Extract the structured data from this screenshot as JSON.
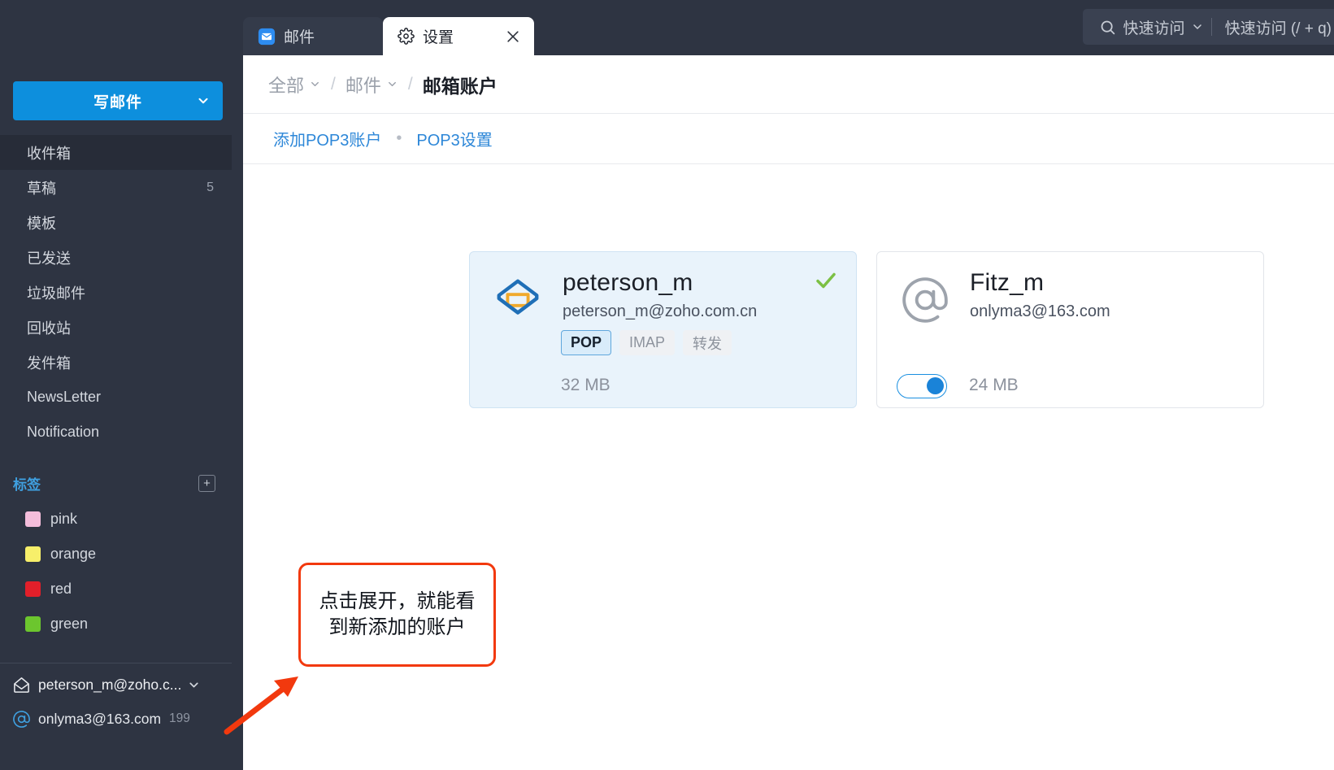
{
  "colors": {
    "sidebar_bg": "#2e3442",
    "accent_blue": "#0d8fdd",
    "link_blue": "#2d87d8",
    "annotation_red": "#f2390e",
    "check_green": "#7cc044",
    "card_selected_bg": "#e9f3fb"
  },
  "topbar": {
    "tabs": [
      {
        "label": "邮件",
        "icon": "mail-app-icon",
        "active": false,
        "closable": false
      },
      {
        "label": "设置",
        "icon": "gear-icon",
        "active": true,
        "closable": true
      }
    ],
    "close_glyph": "✕",
    "quick_access": {
      "search_icon": "search-icon",
      "label": "快速访问",
      "caret_icon": "chevron-down-icon",
      "hint": "快速访问 (/ + q)"
    }
  },
  "sidebar": {
    "compose": {
      "label": "写邮件",
      "caret_icon": "chevron-down-icon"
    },
    "nav_items": [
      {
        "label": "收件箱",
        "count": "",
        "selected": true
      },
      {
        "label": "草稿",
        "count": "5",
        "selected": false
      },
      {
        "label": "模板",
        "count": "",
        "selected": false
      },
      {
        "label": "已发送",
        "count": "",
        "selected": false
      },
      {
        "label": "垃圾邮件",
        "count": "",
        "selected": false
      },
      {
        "label": "回收站",
        "count": "",
        "selected": false
      },
      {
        "label": "发件箱",
        "count": "",
        "selected": false
      },
      {
        "label": "NewsLetter",
        "count": "",
        "selected": false
      },
      {
        "label": "Notification",
        "count": "",
        "selected": false
      }
    ],
    "tags": {
      "title": "标签",
      "add_icon": "plus-icon",
      "add_glyph": "+",
      "items": [
        {
          "name": "pink",
          "color": "#f4bddb"
        },
        {
          "name": "orange",
          "color": "#f7ef6a"
        },
        {
          "name": "red",
          "color": "#e21f2a"
        },
        {
          "name": "green",
          "color": "#6cc62e"
        }
      ]
    },
    "accounts": [
      {
        "address": "peterson_m@zoho.c...",
        "icon": "envelope-open-icon",
        "caret_icon": "chevron-down-icon",
        "count": ""
      },
      {
        "address": "onlyma3@163.com",
        "icon": "at-sign-icon",
        "caret_icon": "",
        "count": "199"
      }
    ]
  },
  "content": {
    "breadcrumb": {
      "items": [
        {
          "label": "全部",
          "has_caret": true
        },
        {
          "label": "邮件",
          "has_caret": true
        }
      ],
      "separator": "/",
      "current": "邮箱账户"
    },
    "subnav": {
      "links": [
        {
          "label": "添加POP3账户"
        },
        {
          "label": "POP3设置"
        }
      ],
      "dot": "•"
    },
    "cards": [
      {
        "name": "peterson_m",
        "email": "peterson_m@zoho.com.cn",
        "avatar_icon": "zoho-mail-logo-icon",
        "verified": true,
        "check_icon": "check-icon",
        "protocols": [
          {
            "label": "POP",
            "active": true
          },
          {
            "label": "IMAP",
            "active": false
          },
          {
            "label": "转发",
            "active": false
          }
        ],
        "size": "32 MB",
        "has_toggle": false
      },
      {
        "name": "Fitz_m",
        "email": "onlyma3@163.com",
        "avatar_icon": "at-sign-icon",
        "verified": false,
        "check_icon": "",
        "protocols": [],
        "size": "24 MB",
        "has_toggle": true,
        "toggle_on": true
      }
    ]
  },
  "annotation": {
    "line1": "点击展开，就能看",
    "line2": "到新添加的账户",
    "arrow_icon": "arrow-up-right-icon"
  }
}
